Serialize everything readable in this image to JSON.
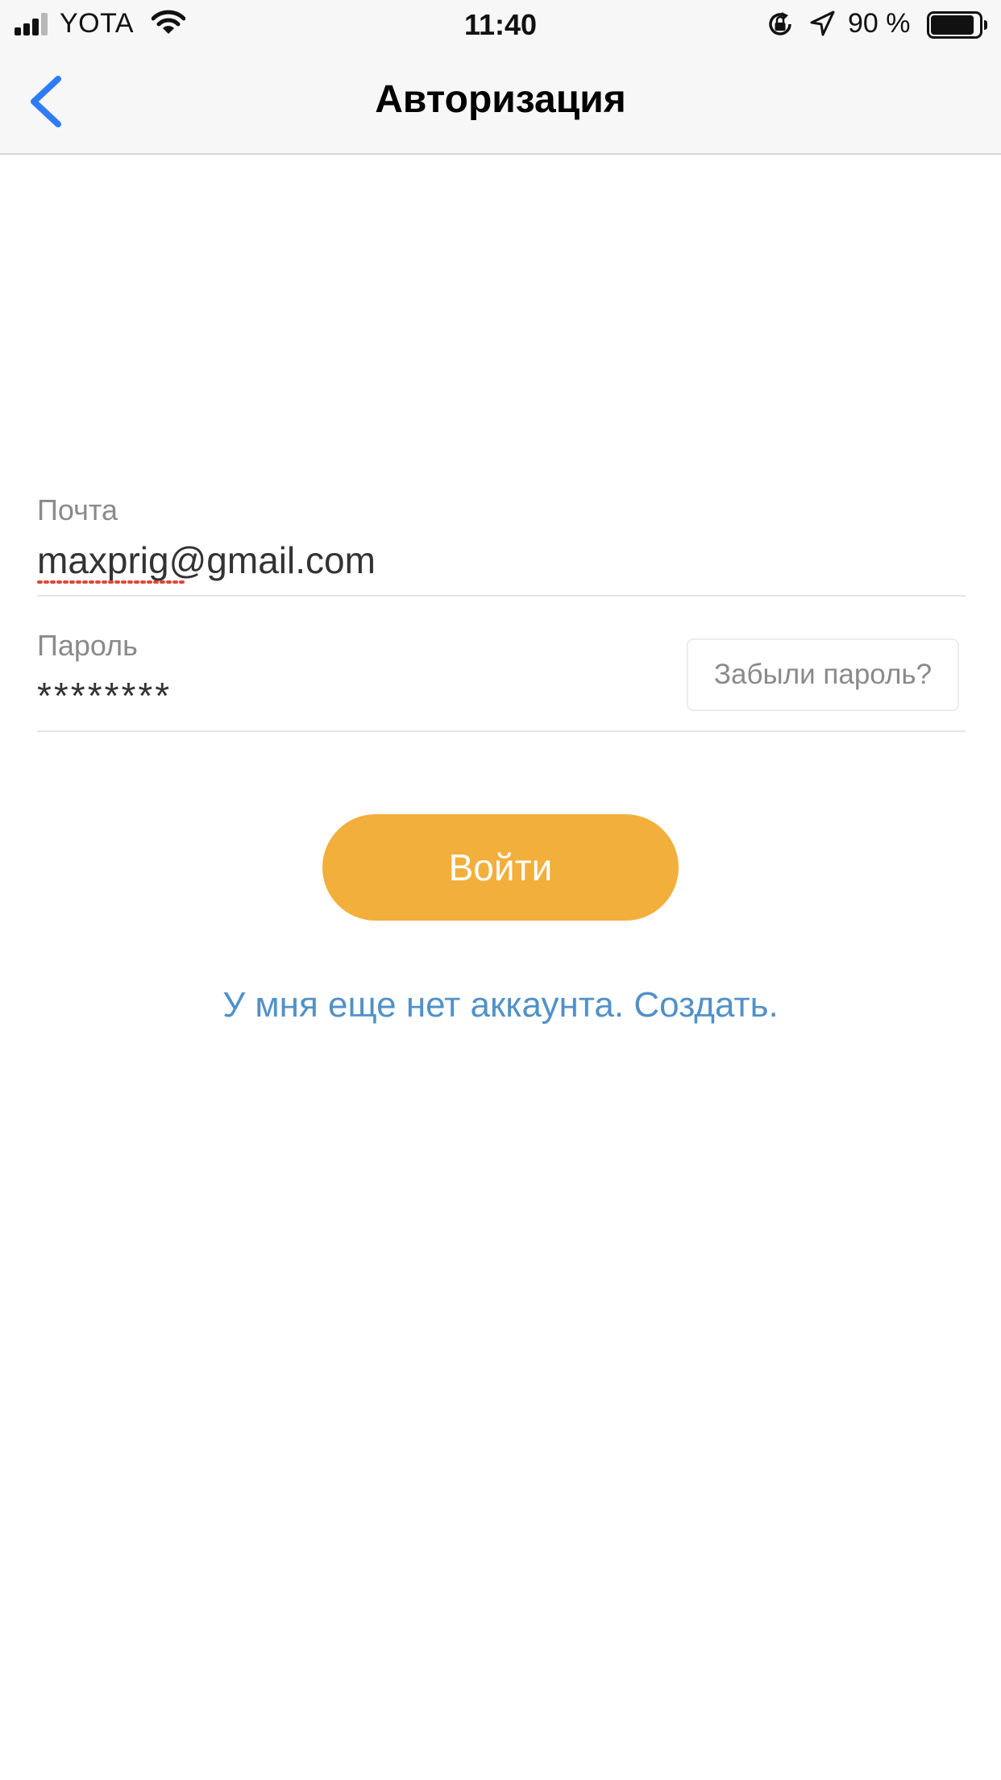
{
  "status_bar": {
    "carrier": "YOTA",
    "time": "11:40",
    "battery_percent": "90 %",
    "battery_level": 0.9,
    "icons": [
      "signal-icon",
      "wifi-icon",
      "rotation-lock-icon",
      "location-arrow-icon",
      "battery-icon"
    ]
  },
  "nav": {
    "title": "Авторизация",
    "back_icon": "chevron-left-icon"
  },
  "form": {
    "email_label": "Почта",
    "email_value": "maxprig@gmail.com",
    "password_label": "Пароль",
    "password_value": "********",
    "forgot_password": "Забыли пароль?"
  },
  "actions": {
    "login_label": "Войти",
    "signup_link": "У мня еще нет аккаунта. Создать."
  },
  "colors": {
    "accent": "#f2af3c",
    "link": "#5191c8",
    "back_chevron": "#2f7cf6",
    "spellcheck": "#e0483c"
  }
}
